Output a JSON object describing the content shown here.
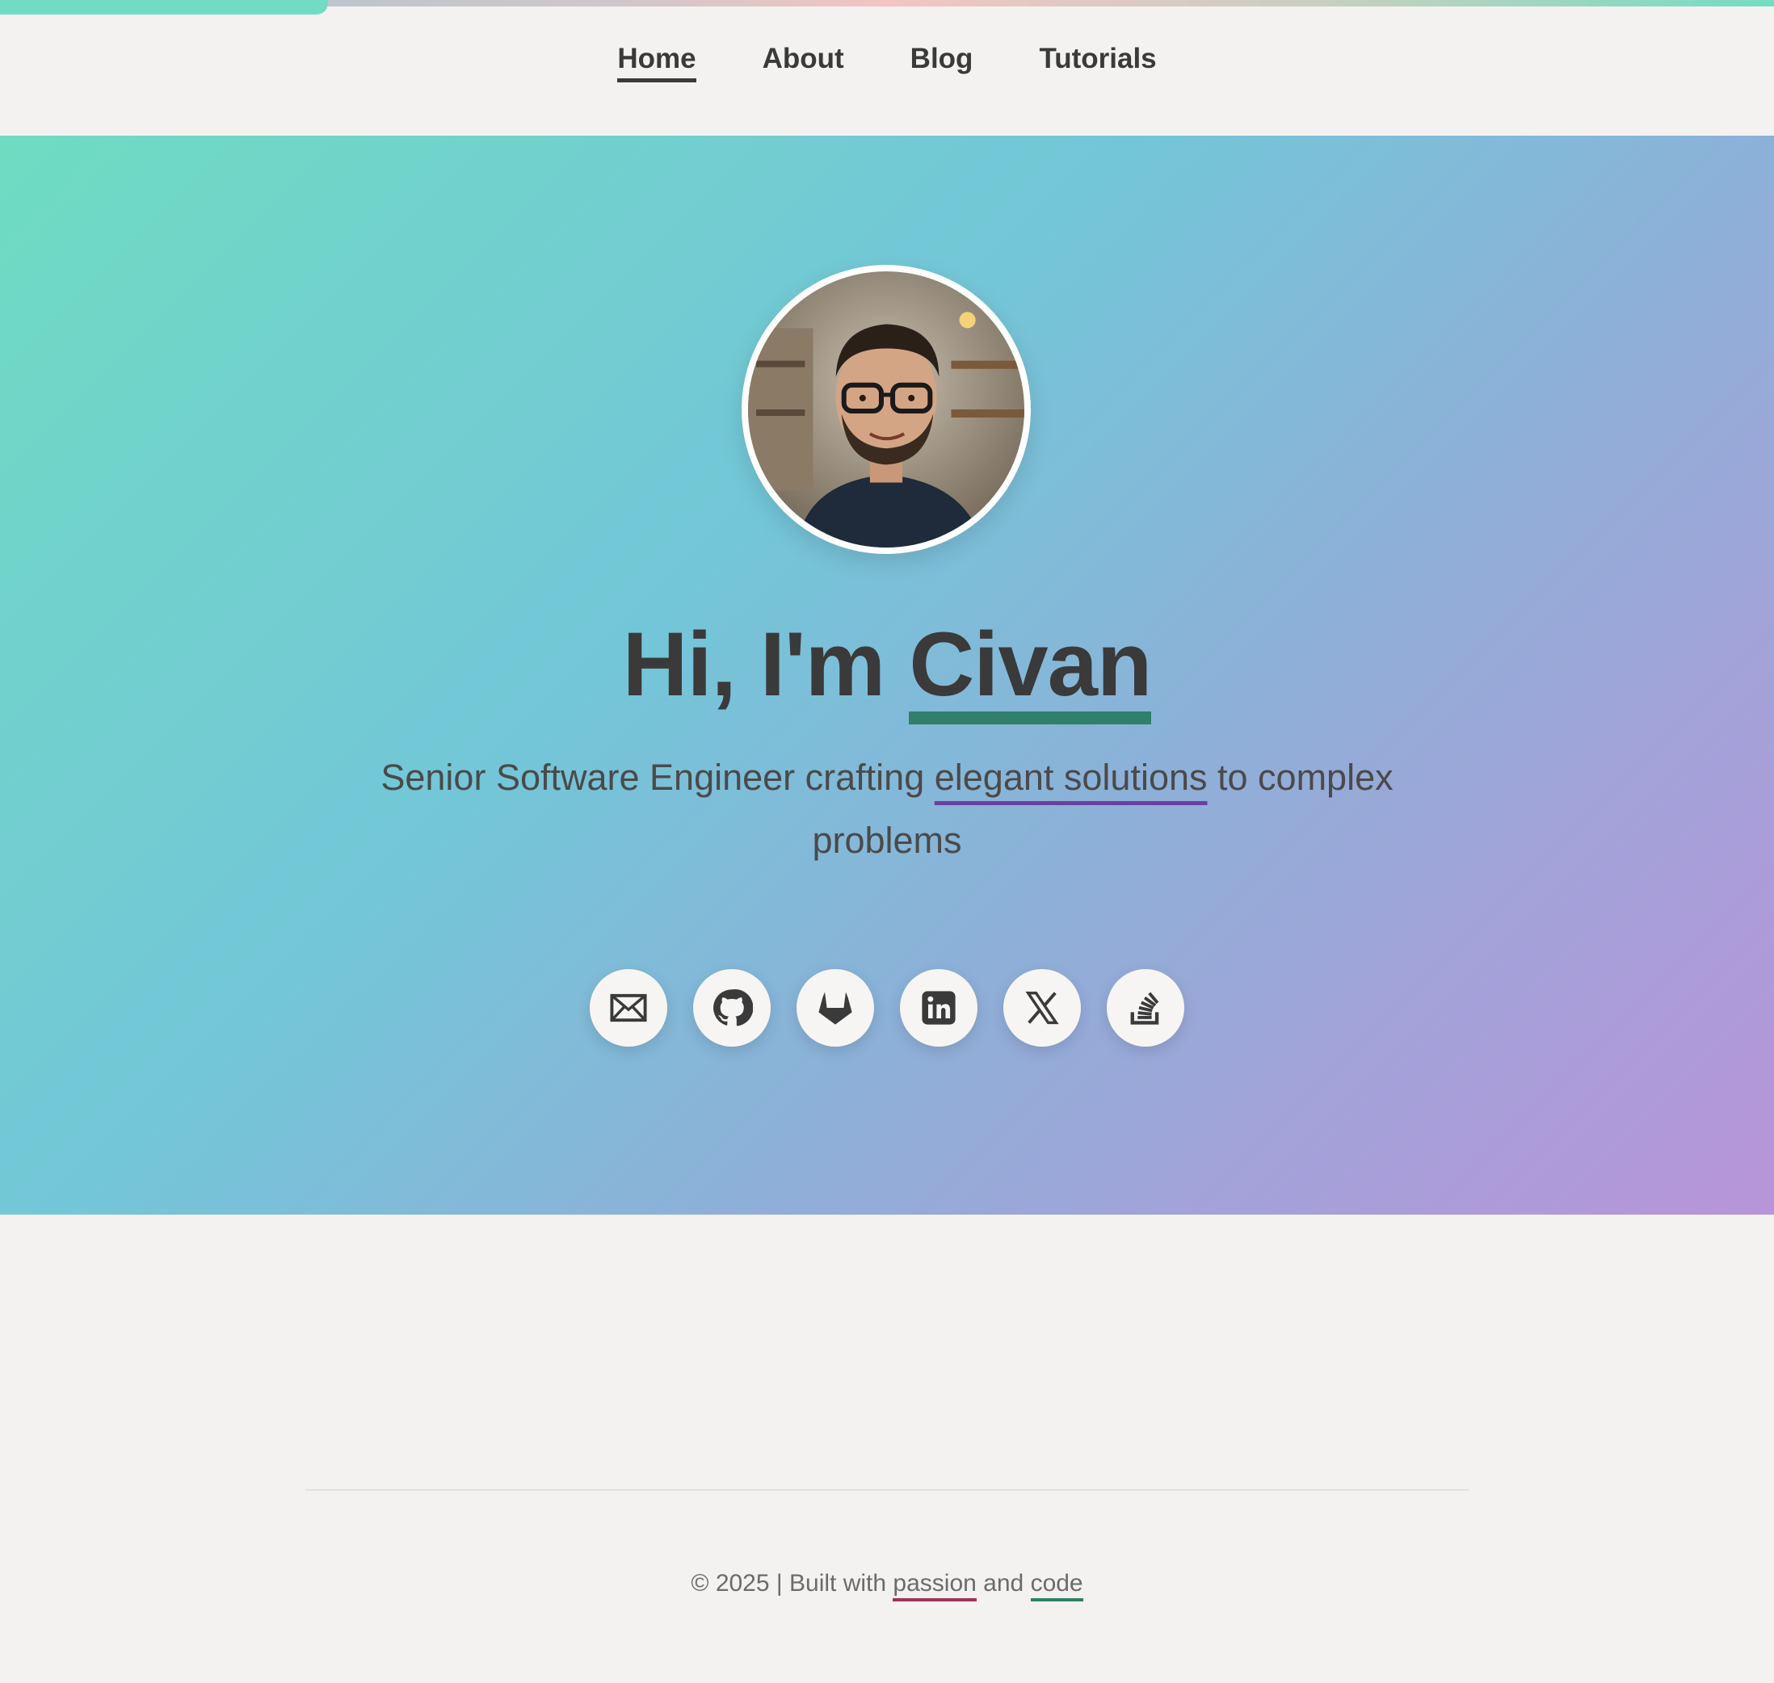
{
  "nav": {
    "items": [
      {
        "label": "Home",
        "active": true
      },
      {
        "label": "About"
      },
      {
        "label": "Blog"
      },
      {
        "label": "Tutorials"
      }
    ]
  },
  "page_progress": 0.185,
  "hero": {
    "greeting": "Hi, I'm",
    "name": "Civan",
    "subtitle_pre": "Senior Software Engineer crafting",
    "subtitle_highlight": "elegant solutions",
    "subtitle_post": "to complex problems",
    "avatar_icon": "profile-photo"
  },
  "socials": [
    {
      "name": "email",
      "icon": "envelope-icon"
    },
    {
      "name": "github",
      "icon": "github-icon"
    },
    {
      "name": "gitlab",
      "icon": "gitlab-icon"
    },
    {
      "name": "linkedin",
      "icon": "linkedin-icon"
    },
    {
      "name": "x",
      "icon": "x-icon"
    },
    {
      "name": "stackoverflow",
      "icon": "stackoverflow-icon"
    }
  ],
  "footer": {
    "prefix": "© 2025 | Built with",
    "passion": "passion",
    "and": "and",
    "code": "code"
  },
  "colors": {
    "accent_green": "#2f7f6a",
    "accent_purple": "#6b3fa0",
    "accent_red": "#a0325e",
    "text": "#3a3a3a"
  }
}
